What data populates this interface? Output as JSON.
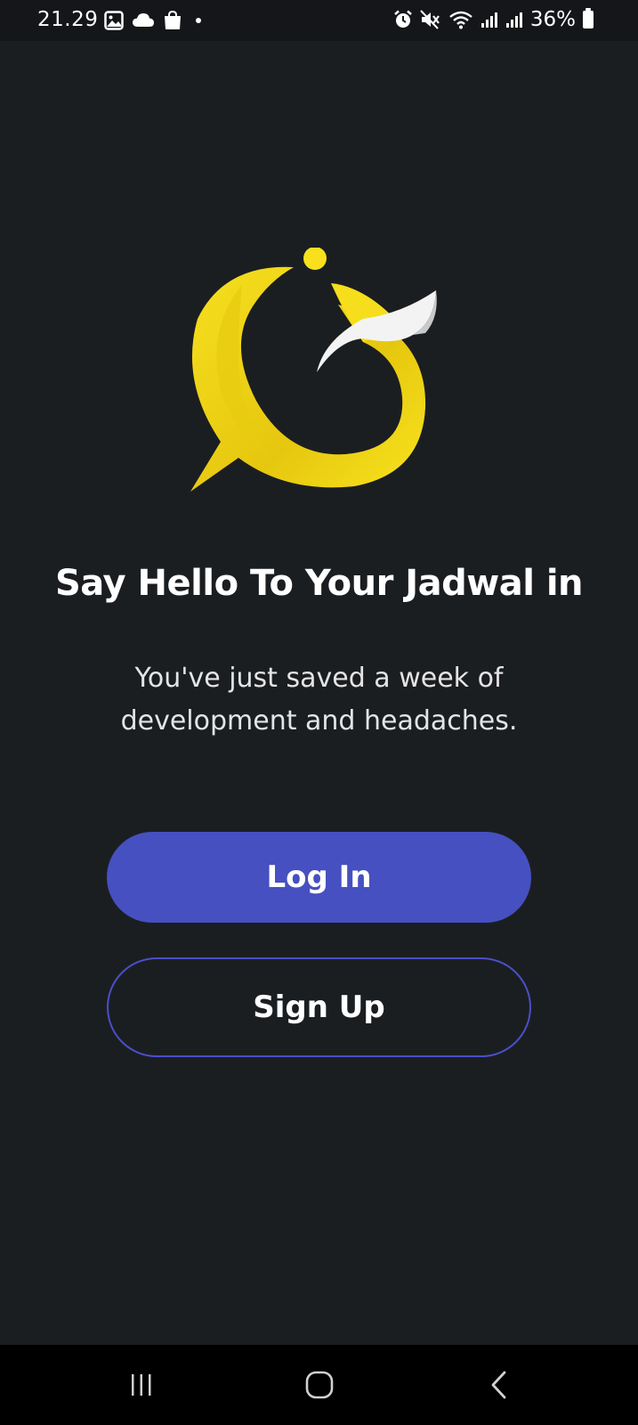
{
  "status_bar": {
    "time": "21.29",
    "battery": "36%",
    "icons": [
      "gallery-icon",
      "cloud-icon",
      "shopping-bag-icon",
      "notification-dot",
      "alarm-icon",
      "mute-icon",
      "wifi-icon",
      "signal-icon",
      "signal-icon-2",
      "battery-icon"
    ]
  },
  "welcome": {
    "title": "Say Hello To Your Jadwal in",
    "subtitle": "You've just saved a week of development and headaches."
  },
  "actions": {
    "login_label": "Log In",
    "signup_label": "Sign Up"
  },
  "colors": {
    "background": "#1b1e21",
    "primary": "#4650c0",
    "logo_yellow": "#f5dc1a"
  },
  "nav_bar": {
    "icons": [
      "recent-apps-icon",
      "home-icon",
      "back-icon"
    ]
  }
}
